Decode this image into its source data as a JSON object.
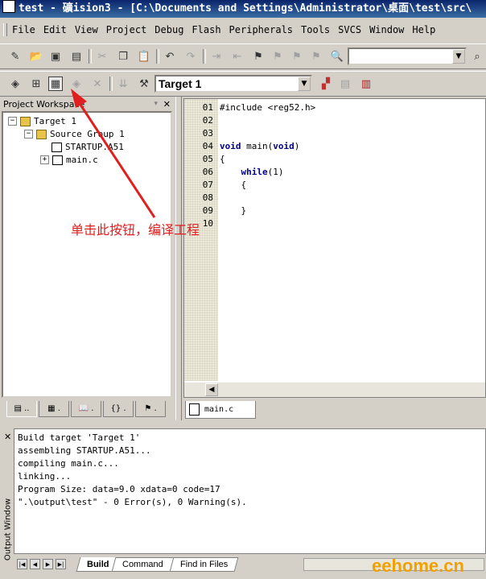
{
  "window": {
    "title": "test  - 礦ision3 - [C:\\Documents and Settings\\Administrator\\桌面\\test\\src\\"
  },
  "menu": [
    "File",
    "Edit",
    "View",
    "Project",
    "Debug",
    "Flash",
    "Peripherals",
    "Tools",
    "SVCS",
    "Window",
    "Help"
  ],
  "toolbar": {
    "target_select": "Target 1",
    "find_value": ""
  },
  "workspace": {
    "title": "Project Workspace",
    "tree": [
      {
        "label": "Target 1",
        "level": 0
      },
      {
        "label": "Source Group 1",
        "level": 1
      },
      {
        "label": "STARTUP.A51",
        "level": 2
      },
      {
        "label": "main.c",
        "level": 2
      }
    ]
  },
  "editor": {
    "tab_label": "main.c",
    "line_numbers": [
      "01",
      "02",
      "03",
      "04",
      "05",
      "06",
      "07",
      "08",
      "09",
      "10"
    ],
    "lines": {
      "l1": "#include <reg52.h>",
      "l4_kw1": "void",
      "l4_mid": " main(",
      "l4_kw2": "void",
      "l4_end": ")",
      "l5": "{",
      "l6_kw": "while",
      "l6_end": "(1)",
      "l7": "    {",
      "l9": "    }"
    }
  },
  "output": {
    "side_label": "Output Window",
    "lines": [
      "Build target 'Target 1'",
      "assembling STARTUP.A51...",
      "compiling main.c...",
      "linking...",
      "Program Size: data=9.0 xdata=0 code=17",
      "\".\\output\\test\" - 0 Error(s), 0 Warning(s)."
    ],
    "tabs": [
      "Build",
      "Command",
      "Find in Files"
    ]
  },
  "annotation": "单击此按钮，编译工程",
  "watermark": "eehome.cn",
  "colors": {
    "annotation": "#e02020",
    "keyword": "#00008b",
    "watermark": "#f0a000"
  }
}
